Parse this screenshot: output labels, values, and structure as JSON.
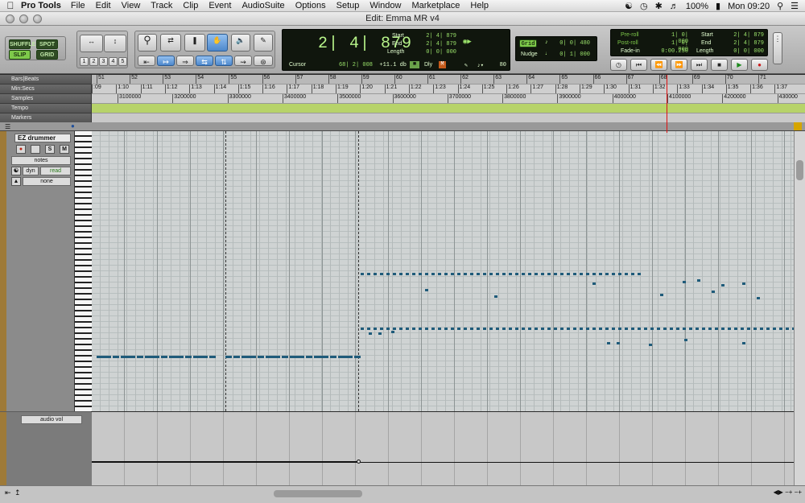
{
  "menubar": {
    "app_name": "Pro Tools",
    "items": [
      "File",
      "Edit",
      "View",
      "Track",
      "Clip",
      "Event",
      "AudioSuite",
      "Options",
      "Setup",
      "Window",
      "Marketplace",
      "Help"
    ],
    "battery": "100%",
    "clock": "Mon 09:20"
  },
  "window": {
    "title": "Edit: Emma MR v4"
  },
  "toolbar": {
    "modes": {
      "shuffle": "SHUFFLE",
      "spot": "SPOT",
      "slip": "SLIP",
      "grid": "GRID"
    },
    "zoom_presets": [
      "1",
      "2",
      "3",
      "4",
      "5"
    ],
    "counter": {
      "main": "2| 4| 879",
      "cursor_label": "Cursor",
      "cursor_value": "68| 2| 008",
      "offset": "+11.1 db",
      "dly": "Dly",
      "value_80": "80"
    },
    "selection": {
      "start_label": "Start",
      "end_label": "End",
      "length_label": "Length",
      "start": "2| 4| 879",
      "end": "2| 4| 879",
      "length": "0| 0| 000"
    },
    "grid": {
      "grid_label": "Grid",
      "grid_value": "0| 0| 480",
      "nudge_label": "Nudge",
      "nudge_value": "0| 1| 000"
    },
    "preroll": {
      "preroll_label": "Pre-roll",
      "preroll_value": "1| 0| 000",
      "postroll_label": "Post-roll",
      "postroll_value": "1| 0| 000",
      "fadein_label": "Fade-in",
      "fadein_value": "0:00.250",
      "start_label": "Start",
      "start_value": "2| 4| 879",
      "end_label": "End",
      "end_value": "2| 4| 879",
      "length_label": "Length",
      "length_value": "0| 0| 000"
    }
  },
  "rulers": {
    "bars_label": "Bars|Beats",
    "minsecs_label": "Min:Secs",
    "samples_label": "Samples",
    "tempo_label": "Tempo",
    "markers_label": "Markers",
    "bars": [
      "51",
      "52",
      "53",
      "54",
      "55",
      "56",
      "57",
      "58",
      "59",
      "60",
      "61",
      "62",
      "63",
      "64",
      "65",
      "66",
      "67",
      "68",
      "69",
      "70",
      "71"
    ],
    "minsecs": [
      ":09",
      "1:10",
      "1:11",
      "1:12",
      "1:13",
      "1:14",
      "1:15",
      "1:16",
      "1:17",
      "1:18",
      "1:19",
      "1:20",
      "1:21",
      "1:22",
      "1:23",
      "1:24",
      "1:25",
      "1:26",
      "1:27",
      "1:28",
      "1:29",
      "1:30",
      "1:31",
      "1:32",
      "1:33",
      "1:34",
      "1:35",
      "1:36",
      "1:37"
    ],
    "samples": [
      "3100000",
      "3200000",
      "3300000",
      "3400000",
      "3500000",
      "3600000",
      "3700000",
      "3800000",
      "3900000",
      "4000000",
      "4100000",
      "4200000",
      "430000"
    ]
  },
  "tracks": {
    "t1_name": "EZ drummer",
    "t1_view": "notes",
    "t1_auto_mode": "dyn",
    "t1_auto_state": "read",
    "t1_group": "none",
    "t2_view": "audio vol"
  },
  "colors": {
    "accent_green": "#7ec94a",
    "lcd_bg": "#10160d",
    "note": "#1f5b7a",
    "track_color": "#9e7a38",
    "playhead": "#dd1111"
  }
}
